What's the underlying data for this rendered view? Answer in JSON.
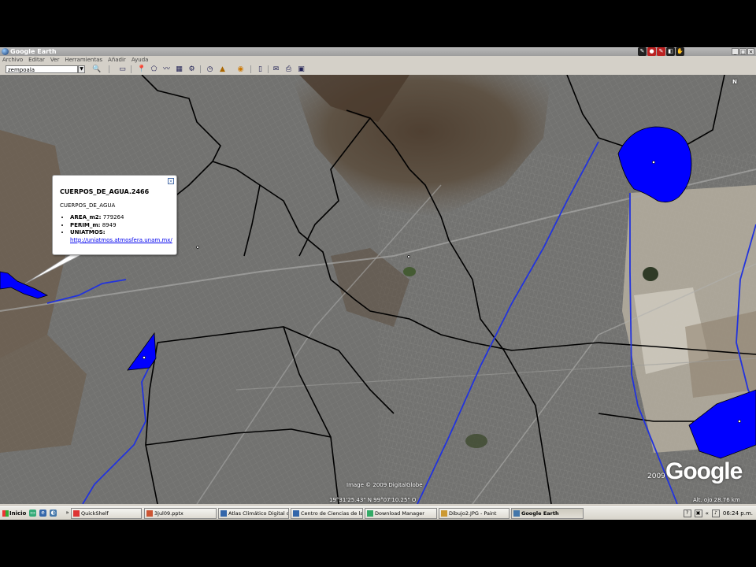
{
  "window": {
    "title": "Google Earth"
  },
  "menu": [
    "Archivo",
    "Editar",
    "Ver",
    "Herramientas",
    "Añadir",
    "Ayuda"
  ],
  "search": {
    "value": "zempoala"
  },
  "balloon": {
    "title": "CUERPOS_DE_AGUA.2466",
    "subtitle": "CUERPOS_DE_AGUA",
    "fields": [
      {
        "key": "AREA_m2:",
        "value": "779264"
      },
      {
        "key": "PERIM_m:",
        "value": "8949"
      },
      {
        "key": "UNIATMOS:",
        "value": ""
      }
    ],
    "link": "http://uniatmos.atmosfera.unam.mx/"
  },
  "map_overlay": {
    "image_credit": "Image © 2009 DigitalGlobe",
    "coordinates": "19°31'25.43\" N   99°07'10.25\" O",
    "logo_year": "2009",
    "logo": "Google",
    "eye_alt": "Alt. ojo  28.76 km",
    "compass_letter": "N"
  },
  "taskbar": {
    "start_label": "Inicio",
    "tasks": [
      {
        "label": "QuickShelf",
        "active": false,
        "color": "#d33"
      },
      {
        "label": "3jul09.pptx",
        "active": false,
        "color": "#c53"
      },
      {
        "label": "Atlas Climático Digital de ...",
        "active": false,
        "color": "#36a"
      },
      {
        "label": "Centro de Ciencias de la ...",
        "active": false,
        "color": "#36a"
      },
      {
        "label": "Download Manager",
        "active": false,
        "color": "#3a6"
      },
      {
        "label": "Dibujo2.JPG - Paint",
        "active": false,
        "color": "#c93"
      },
      {
        "label": "Google Earth",
        "active": true,
        "color": "#47a"
      }
    ],
    "clock": "06:24 p.m."
  },
  "colors": {
    "water_polygon": "#0000ff",
    "boundary_line": "#000000",
    "blue_line": "#2233dd"
  }
}
